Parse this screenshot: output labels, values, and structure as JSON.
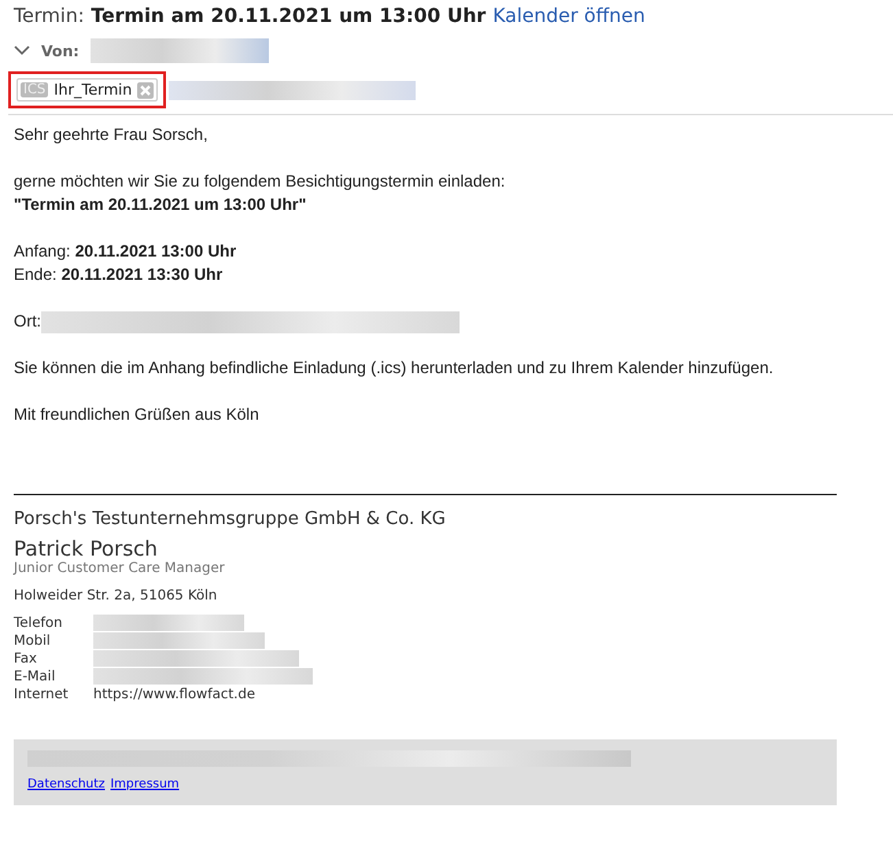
{
  "header": {
    "label": "Termin:",
    "subject": "Termin am 20.11.2021 um 13:00 Uhr",
    "link": "Kalender öffnen"
  },
  "from": {
    "label": "Von:",
    "expanded": false
  },
  "attachment": {
    "type": "ICS",
    "name": "Ihr_Termin",
    "highlighted": true
  },
  "body": {
    "greeting": "Sehr geehrte Frau Sorsch,",
    "intro": "gerne möchten wir Sie zu folgendem Besichtigungstermin einladen:",
    "title": "\"Termin am 20.11.2021 um 13:00 Uhr\"",
    "start_label": "Anfang:",
    "start": "20.11.2021 13:00 Uhr",
    "end_label": "Ende:",
    "end": "20.11.2021 13:30 Uhr",
    "place_label": "Ort:",
    "note": "Sie können die im Anhang befindliche Einladung (.ics) herunterladen und zu Ihrem Kalender hinzufügen.",
    "closing": "Mit freundlichen Grüßen aus Köln"
  },
  "signature": {
    "company": "Porsch's Testunternehmsgruppe GmbH & Co. KG",
    "name": "Patrick Porsch",
    "role": "Junior Customer Care Manager",
    "address": "Holweider Str. 2a, 51065 Köln",
    "contacts": [
      {
        "label": "Telefon"
      },
      {
        "label": "Mobil"
      },
      {
        "label": "Fax"
      },
      {
        "label": "E-Mail"
      },
      {
        "label": "Internet",
        "value": "https://www.flowfact.de"
      }
    ]
  },
  "footer": {
    "links": [
      "Datenschutz",
      "Impressum"
    ]
  }
}
